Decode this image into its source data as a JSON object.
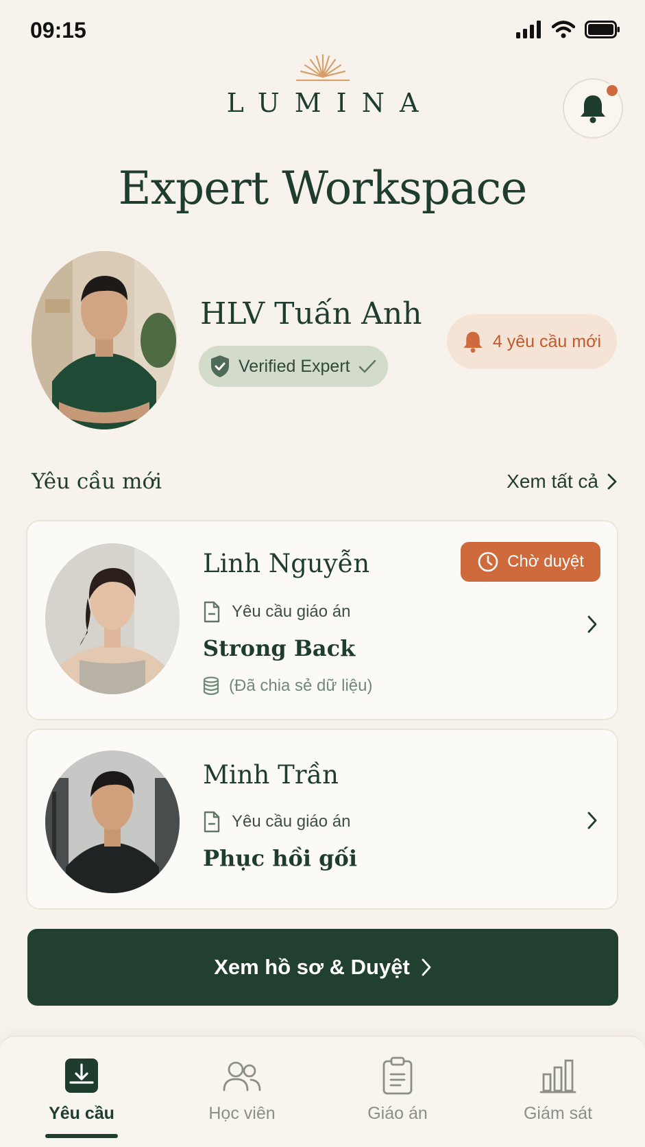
{
  "status_bar": {
    "time": "09:15"
  },
  "header": {
    "logo_text": "LUMINA",
    "title": "Expert Workspace"
  },
  "profile": {
    "name": "HLV Tuấn Anh",
    "verified_label": "Verified Expert",
    "new_requests_label": "4 yêu cầu mới"
  },
  "section": {
    "title": "Yêu cầu mới",
    "see_all": "Xem tất cả"
  },
  "requests": [
    {
      "name": "Linh Nguyễn",
      "status": "Chờ duyệt",
      "type": "Yêu cầu giáo án",
      "plan": "Strong Back",
      "shared_note": "(Đã chia sẻ dữ liệu)"
    },
    {
      "name": "Minh Trần",
      "type": "Yêu cầu giáo án",
      "plan": "Phục hồi gối"
    }
  ],
  "cta": {
    "label": "Xem hồ sơ & Duyệt"
  },
  "bottom_nav": [
    {
      "label": "Yêu cầu",
      "icon": "inbox-download-icon",
      "active": true
    },
    {
      "label": "Học viên",
      "icon": "users-icon",
      "active": false
    },
    {
      "label": "Giáo án",
      "icon": "clipboard-icon",
      "active": false
    },
    {
      "label": "Giám sát",
      "icon": "bar-chart-icon",
      "active": false
    }
  ],
  "colors": {
    "background": "#f7f3ec",
    "primary": "#1f3d2e",
    "accent": "#cf6a3c",
    "verified_bg": "#d3dccb",
    "badge_bg": "#f5e3d6"
  }
}
